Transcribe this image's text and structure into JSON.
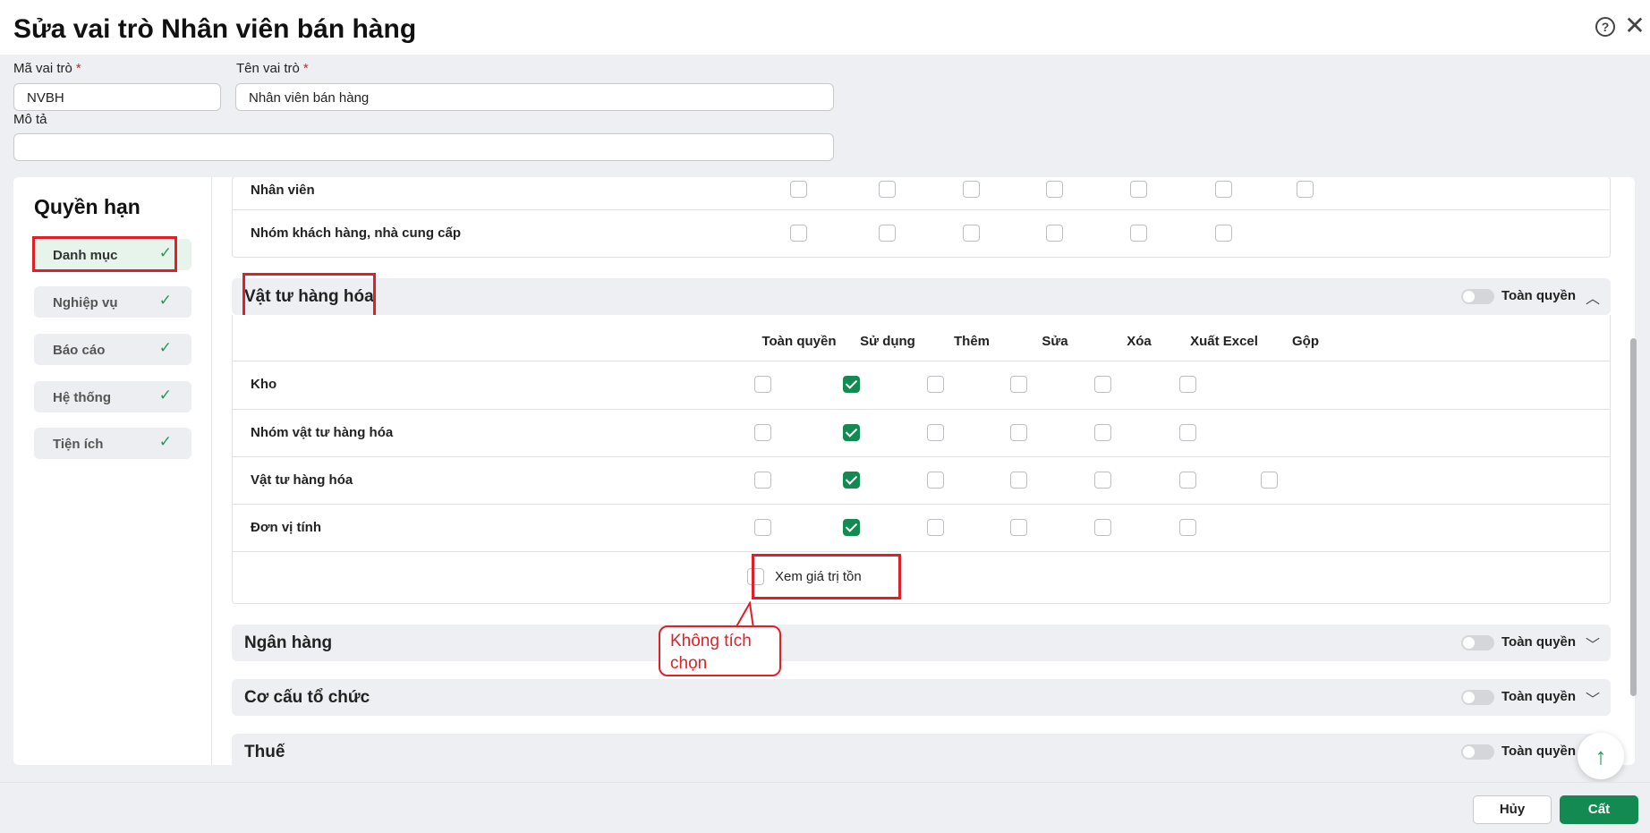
{
  "dialog": {
    "title": "Sửa vai trò Nhân viên bán hàng"
  },
  "form": {
    "code_label": "Mã vai trò",
    "code_value": "NVBH",
    "name_label": "Tên vai trò",
    "name_value": "Nhân viên bán hàng",
    "desc_label": "Mô tả",
    "desc_value": "",
    "required_mark": "*"
  },
  "sidebar": {
    "heading": "Quyền hạn",
    "items": [
      {
        "label": "Danh mục",
        "active": true
      },
      {
        "label": "Nghiệp vụ",
        "active": false
      },
      {
        "label": "Báo cáo",
        "active": false
      },
      {
        "label": "Hệ thống",
        "active": false
      },
      {
        "label": "Tiện ích",
        "active": false
      }
    ],
    "check_glyph": "✓"
  },
  "columns": [
    "Toàn quyền",
    "Sử dụng",
    "Thêm",
    "Sửa",
    "Xóa",
    "Xuất Excel",
    "Gộp"
  ],
  "top_block": {
    "rows": [
      {
        "name": "Nhân viên",
        "checks": [
          false,
          false,
          false,
          false,
          false,
          false,
          false
        ]
      },
      {
        "name": "Nhóm khách hàng, nhà cung cấp",
        "checks": [
          false,
          false,
          false,
          false,
          false,
          false
        ]
      }
    ]
  },
  "sections": [
    {
      "title": "Vật tư hàng hóa",
      "toggle_label": "Toàn quyền",
      "toggle_on": false,
      "expanded": true,
      "rows": [
        {
          "name": "Kho",
          "checks": [
            false,
            true,
            false,
            false,
            false,
            false
          ]
        },
        {
          "name": "Nhóm vật tư hàng hóa",
          "checks": [
            false,
            true,
            false,
            false,
            false,
            false
          ]
        },
        {
          "name": "Vật tư hàng hóa",
          "checks": [
            false,
            true,
            false,
            false,
            false,
            false,
            false
          ]
        },
        {
          "name": "Đơn vị tính",
          "checks": [
            false,
            true,
            false,
            false,
            false,
            false
          ]
        }
      ],
      "extra_option": {
        "label": "Xem giá trị tồn",
        "checked": false
      }
    },
    {
      "title": "Ngân hàng",
      "toggle_label": "Toàn quyền",
      "toggle_on": false,
      "expanded": false
    },
    {
      "title": "Cơ cấu tổ chức",
      "toggle_label": "Toàn quyền",
      "toggle_on": false,
      "expanded": false
    },
    {
      "title": "Thuế",
      "toggle_label": "Toàn quyền",
      "toggle_on": false,
      "expanded": false
    }
  ],
  "annotation": {
    "text": "Không tích chọn"
  },
  "footer": {
    "cancel_label": "Hủy",
    "save_label": "Cất"
  },
  "colors": {
    "accent": "#138a52",
    "highlight": "#e01f26"
  },
  "icons": {
    "help": "question-circle-icon",
    "close": "close-icon",
    "scroll_top": "arrow-up-icon"
  }
}
